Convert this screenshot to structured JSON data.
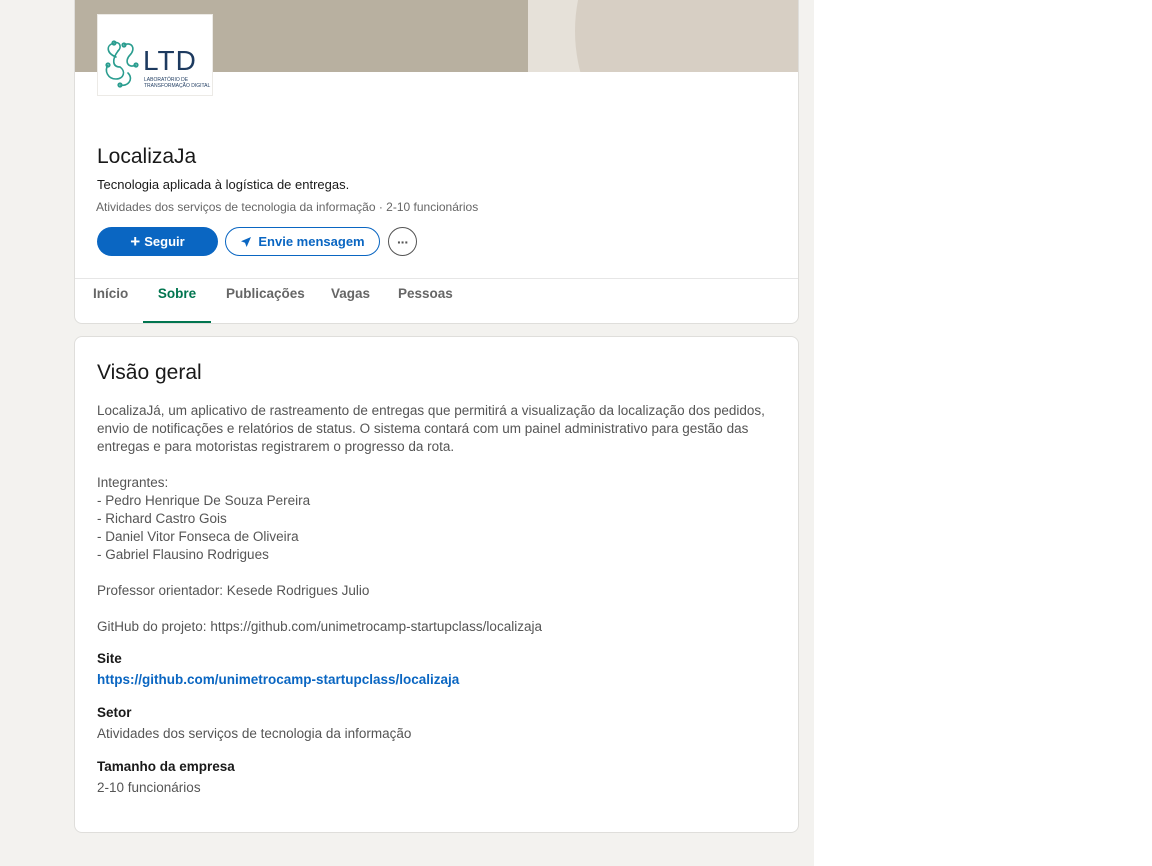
{
  "company": {
    "logo_text": "LTD",
    "logo_subtext_1": "LABORATÓRIO DE",
    "logo_subtext_2": "TRANSFORMAÇÃO DIGITAL",
    "name": "LocalizaJa",
    "tagline": "Tecnologia aplicada à logística de entregas.",
    "meta": "Atividades dos serviços de tecnologia da informação · 2-10 funcionários"
  },
  "actions": {
    "follow_icon": "+",
    "follow_label": "Seguir",
    "message_label": "Envie mensagem",
    "more_icon": "···"
  },
  "tabs": [
    {
      "label": "Início",
      "active": false
    },
    {
      "label": "Sobre",
      "active": true
    },
    {
      "label": "Publicações",
      "active": false
    },
    {
      "label": "Vagas",
      "active": false
    },
    {
      "label": "Pessoas",
      "active": false
    }
  ],
  "about": {
    "title": "Visão geral",
    "description": "LocalizaJá, um aplicativo de rastreamento de entregas que permitirá a visualização da localização dos pedidos, envio de notificações e relatórios de status. O sistema contará com um painel administrativo para gestão das entregas e para motoristas registrarem o progresso da rota.\n\nIntegrantes:\n- Pedro Henrique De Souza Pereira\n- Richard Castro Gois\n- Daniel Vitor Fonseca de Oliveira\n- Gabriel Flausino Rodrigues\n\nProfessor orientador: Kesede Rodrigues Julio\n\nGitHub do projeto: https://github.com/unimetrocamp-startupclass/localizaja",
    "site_label": "Site",
    "site_value": "https://github.com/unimetrocamp-startupclass/localizaja",
    "sector_label": "Setor",
    "sector_value": "Atividades dos serviços de tecnologia da informação",
    "size_label": "Tamanho da empresa",
    "size_value": "2-10 funcionários"
  },
  "colors": {
    "accent_blue": "#0a66c2",
    "active_tab_green": "#01754f",
    "page_background": "#f3f2ef"
  }
}
